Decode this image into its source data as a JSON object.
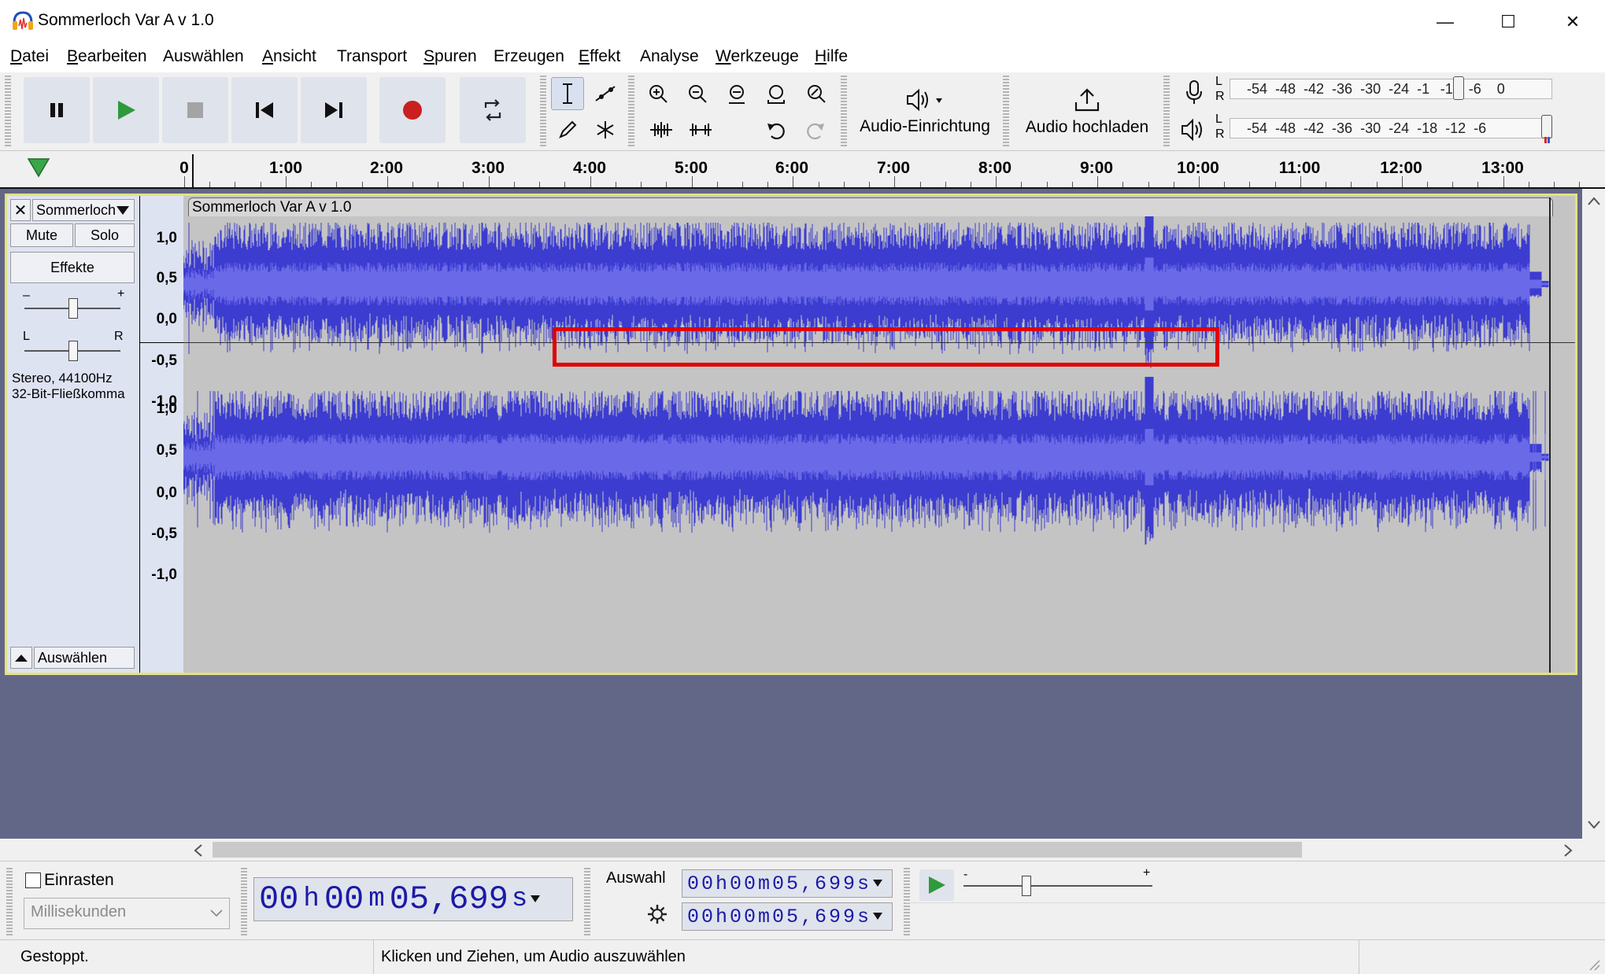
{
  "window": {
    "title": "Sommerloch Var A v 1.0",
    "minimize": "—",
    "maximize": "☐",
    "close": "✕"
  },
  "menu": [
    {
      "u": "D",
      "rest": "atei"
    },
    {
      "u": "B",
      "rest": "earbeiten"
    },
    {
      "u": "",
      "rest": "Auswählen"
    },
    {
      "u": "A",
      "rest": "nsicht"
    },
    {
      "u": "",
      "rest": "Transport"
    },
    {
      "u": "S",
      "rest": "puren"
    },
    {
      "u": "",
      "rest": "Erzeugen"
    },
    {
      "u": "E",
      "rest": "ffekt"
    },
    {
      "u": "",
      "rest": "Analyse"
    },
    {
      "u": "W",
      "rest": "erkzeuge"
    },
    {
      "u": "H",
      "rest": "ilfe"
    }
  ],
  "toolbar": {
    "audio_setup": "Audio-Einrichtung",
    "share_audio": "Audio hochladen",
    "meter_scale_rec": "-54  -48  -42  -36  -30  -24  -1   -12  -6    0",
    "meter_scale_play": "-54  -48  -42  -36  -30  -24  -18  -12  -6",
    "meter_L": "L",
    "meter_R": "R"
  },
  "ruler": {
    "labels": [
      "0",
      "1:00",
      "2:00",
      "3:00",
      "4:00",
      "5:00",
      "6:00",
      "7:00",
      "8:00",
      "9:00",
      "10:00",
      "11:00",
      "12:00",
      "13:00"
    ]
  },
  "track": {
    "name": "Sommerloch",
    "clip_name": "Sommerloch Var A v 1.0",
    "mute": "Mute",
    "solo": "Solo",
    "effects": "Effekte",
    "gain_minus": "–",
    "gain_plus": "+",
    "pan_left": "L",
    "pan_right": "R",
    "format_line1": "Stereo, 44100Hz",
    "format_line2": "32-Bit-Fließkomma",
    "select": "Auswählen",
    "vscale": [
      "1,0",
      "0,5",
      "0,0",
      "-0,5",
      "-1,0"
    ]
  },
  "bottom": {
    "snap_label": "Einrasten",
    "snap_unit": "Millisekunden",
    "time_display": [
      "00",
      "h",
      "00",
      "m",
      "05,699",
      "s"
    ],
    "selection_label": "Auswahl",
    "sel_start": "00h00m05,699s",
    "sel_end": "00h00m05,699s",
    "speed_minus": "-",
    "speed_plus": "+"
  },
  "status": {
    "state": "Gestoppt.",
    "hint": "Klicken und Ziehen, um Audio auszuwählen"
  },
  "colors": {
    "waveform": "#3c3cd0",
    "waveform_rms": "#6a6ae8",
    "highlight_box": "#e00000",
    "track_bg": "#636787"
  }
}
